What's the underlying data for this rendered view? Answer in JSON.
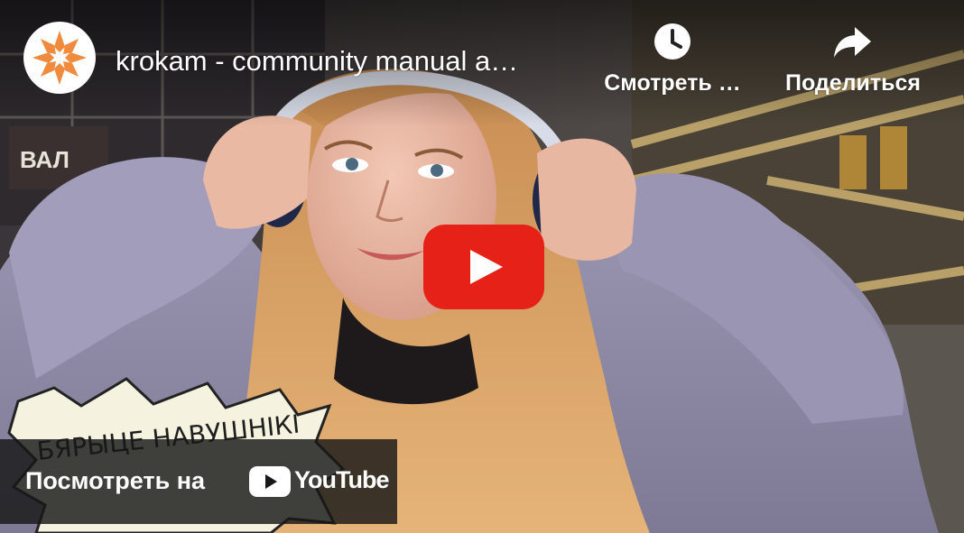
{
  "video": {
    "title": "krokam - community manual a…",
    "channel_logo": "krokam-star-logo",
    "sticker_text": "БЯРЫЦЕ НАВУШНІКІ"
  },
  "controls": {
    "watch_later_label": "Смотреть …",
    "watch_later_icon": "clock-icon",
    "share_label": "Поделиться",
    "share_icon": "share-arrow-icon",
    "play_icon": "youtube-play-icon"
  },
  "watch_on": {
    "label": "Посмотреть на",
    "brand": "YouTube"
  },
  "colors": {
    "play_red": "#e62117",
    "logo_orange": "#f08a3c",
    "coat": "#8e8aa6",
    "hair": "#d8a060"
  }
}
